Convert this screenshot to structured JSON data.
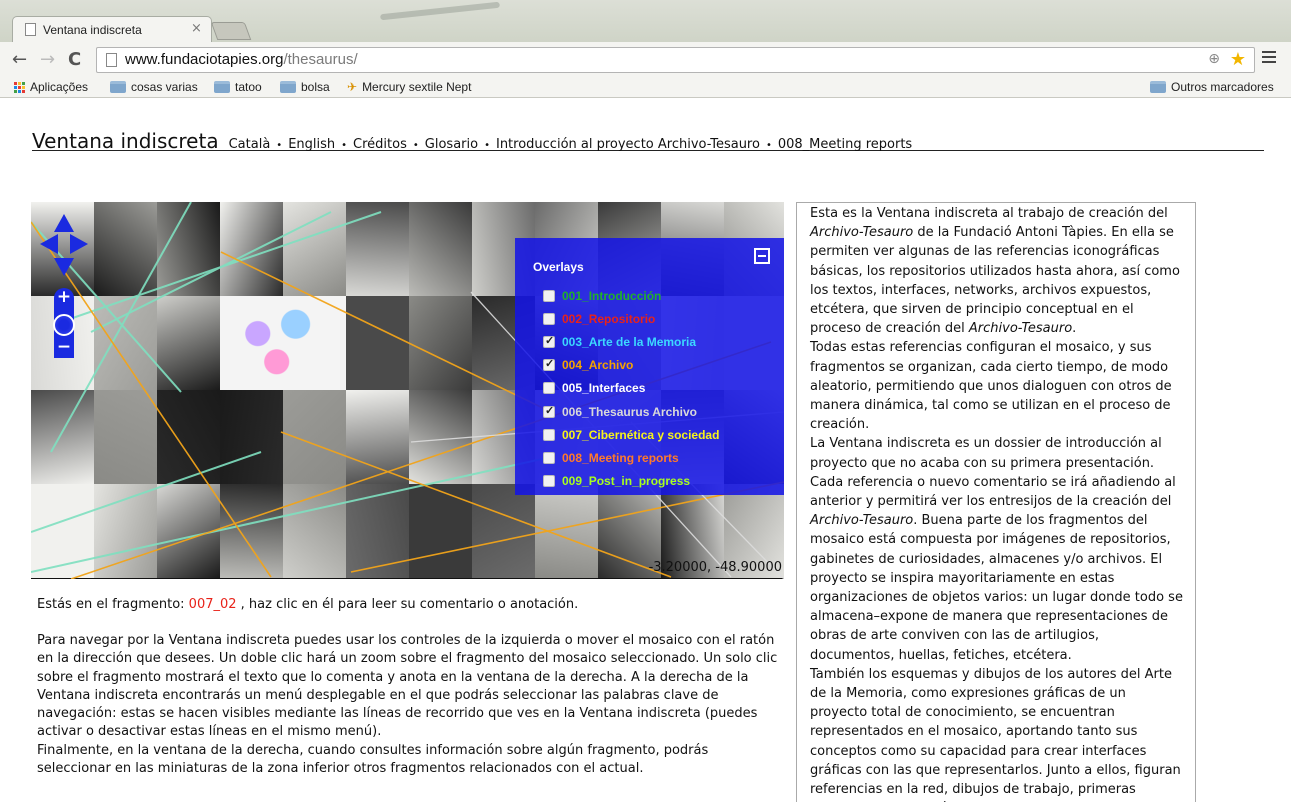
{
  "browser": {
    "tab_title": "Ventana indiscreta",
    "tab_close": "×",
    "url_domain": "www.fundaciotapies.org",
    "url_path": "/thesaurus/",
    "bookmarks": [
      {
        "label": "Aplicações",
        "icon": "apps-icon"
      },
      {
        "label": "cosas varias",
        "icon": "folder-icon"
      },
      {
        "label": "tatoo",
        "icon": "folder-icon"
      },
      {
        "label": "bolsa",
        "icon": "folder-icon"
      },
      {
        "label": "Mercury sextile Nept",
        "icon": "plane-icon"
      }
    ],
    "other_bookmarks": "Outros marcadores"
  },
  "header": {
    "title": "Ventana indiscreta",
    "nav": [
      "Català",
      "English",
      "Créditos",
      "Glosario",
      "Introducción al proyecto Archivo-Tesauro",
      "008_Meeting reports"
    ],
    "separator": "•"
  },
  "viewer": {
    "overlays_title": "Overlays",
    "overlays": [
      {
        "label": "001_Introducción",
        "checked": false,
        "color": "#22b02a"
      },
      {
        "label": "002_Repositorio",
        "checked": false,
        "color": "#e8231a"
      },
      {
        "label": "003_Arte de la Memoria",
        "checked": true,
        "color": "#3cd8ff"
      },
      {
        "label": "004_Archivo",
        "checked": true,
        "color": "#f5a300"
      },
      {
        "label": "005_Interfaces",
        "checked": false,
        "color": "#ffffff"
      },
      {
        "label": "006_Thesaurus Archivo",
        "checked": true,
        "color": "#d9d9d9"
      },
      {
        "label": "007_Cibernética y sociedad",
        "checked": false,
        "color": "#f7f31a"
      },
      {
        "label": "008_Meeting reports",
        "checked": false,
        "color": "#ff7a2a"
      },
      {
        "label": "009_Post_in_progress",
        "checked": false,
        "color": "#a8ff1e"
      }
    ],
    "coordinates": "-3.20000, -48.90000"
  },
  "fragment": {
    "prefix": "Estás en el fragmento: ",
    "id": "007_02",
    "suffix": " , haz clic en él para leer su comentario o anotación."
  },
  "instructions": [
    "Para navegar por la Ventana indiscreta puedes usar los controles de la izquierda o mover el mosaico con el ratón en la dirección que desees. Un doble clic hará un zoom sobre el fragmento del mosaico seleccionado. Un solo clic sobre el fragmento mostrará el texto que lo comenta y anota en la ventana de la derecha. A la derecha de la Ventana indiscreta encontrarás un menú desplegable en el que podrás seleccionar las palabras clave de navegación: estas se hacen visibles mediante las líneas de recorrido que ves en la Ventana indiscreta (puedes activar o desactivar estas líneas en el mismo menú).",
    "Finalmente, en la ventana de la derecha, cuando consultes información sobre algún fragmento, podrás seleccionar en las miniaturas de la zona inferior otros fragmentos relacionados con el actual."
  ],
  "right_panel": {
    "p1_a": "Esta es la Ventana indiscreta al trabajo de creación del ",
    "p1_em1": "Archivo-Tesauro",
    "p1_b": " de la Fundació Antoni Tàpies. En ella se permiten ver algunas de las referencias iconográficas básicas, los repositorios utilizados hasta ahora, así como los textos, interfaces, networks, archivos expuestos, etcétera, que sirven de principio conceptual en el proceso de creación del ",
    "p1_em2": "Archivo-Tesauro",
    "p1_c": ".",
    "p2": "Todas estas referencias configuran el mosaico, y sus fragmentos se organizan, cada cierto tiempo, de modo aleatorio, permitiendo que unos dialoguen con otros de manera dinámica, tal como se utilizan en el proceso de creación.",
    "p3_a": "La Ventana indiscreta es un dossier de introducción al proyecto que no acaba con su primera presentación. Cada referencia o nuevo comentario se irá añadiendo al anterior y permitirá ver los entresijos de la creación del ",
    "p3_em": "Archivo-Tesauro",
    "p3_b": ". Buena parte de los fragmentos del mosaico está compuesta por imágenes de repositorios, gabinetes de curiosidades, almacenes y/o archivos. El proyecto se inspira mayoritariamente en estas organizaciones de objetos varios: un lugar donde todo se almacena–expone de manera que representaciones de obras de arte conviven con las de artilugios, documentos, huellas, fetiches, etcétera.",
    "p4": "También los esquemas y dibujos de los autores del Arte de la Memoria, como expresiones gráficas de un proyecto total de conocimiento, se encuentran representados en el mosaico, aportando tanto sus conceptos como su capacidad para crear interfaces gráficas con las que representarlos. Junto a ellos, figuran referencias en la red, dibujos de trabajo, primeras representaciones gráficas del"
  }
}
